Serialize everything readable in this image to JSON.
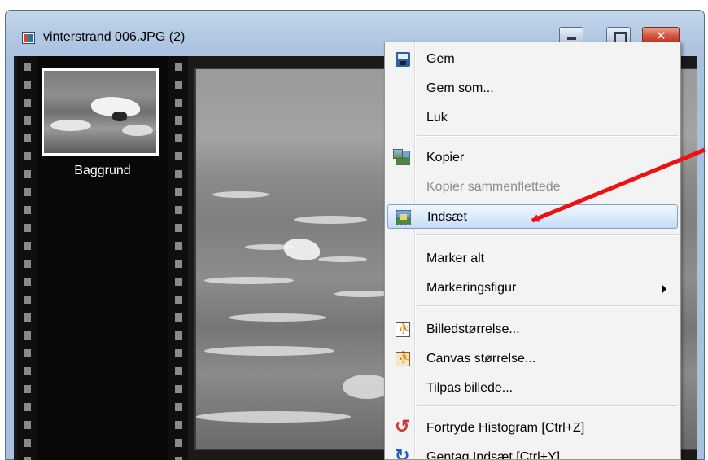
{
  "window": {
    "title": "vinterstrand 006.JPG (2)"
  },
  "layers": {
    "items": [
      {
        "label": "Baggrund"
      }
    ]
  },
  "context_menu": {
    "items": [
      {
        "label": "Gem",
        "icon": "save-icon",
        "enabled": true
      },
      {
        "label": "Gem som...",
        "enabled": true
      },
      {
        "label": "Luk",
        "enabled": true
      },
      {
        "label": "Kopier",
        "icon": "copy-icon",
        "enabled": true
      },
      {
        "label": "Kopier sammenflettede",
        "enabled": false
      },
      {
        "label": "Indsæt",
        "icon": "paste-icon",
        "enabled": true,
        "highlighted": true
      },
      {
        "label": "Marker alt",
        "enabled": true
      },
      {
        "label": "Markeringsfigur",
        "enabled": true,
        "submenu": true
      },
      {
        "label": "Billedstørrelse...",
        "icon": "image-size-icon",
        "enabled": true
      },
      {
        "label": "Canvas størrelse...",
        "icon": "canvas-size-icon",
        "enabled": true
      },
      {
        "label": "Tilpas billede...",
        "enabled": true
      },
      {
        "label": "Fortryde Histogram [Ctrl+Z]",
        "icon": "undo-icon",
        "enabled": true
      },
      {
        "label": "Gentag Indsæt [Ctrl+Y]",
        "icon": "redo-icon",
        "enabled": true
      }
    ]
  },
  "colors": {
    "highlight_border": "#7da2ce",
    "annotation_arrow": "#ee1111",
    "close_button": "#d2543f"
  }
}
